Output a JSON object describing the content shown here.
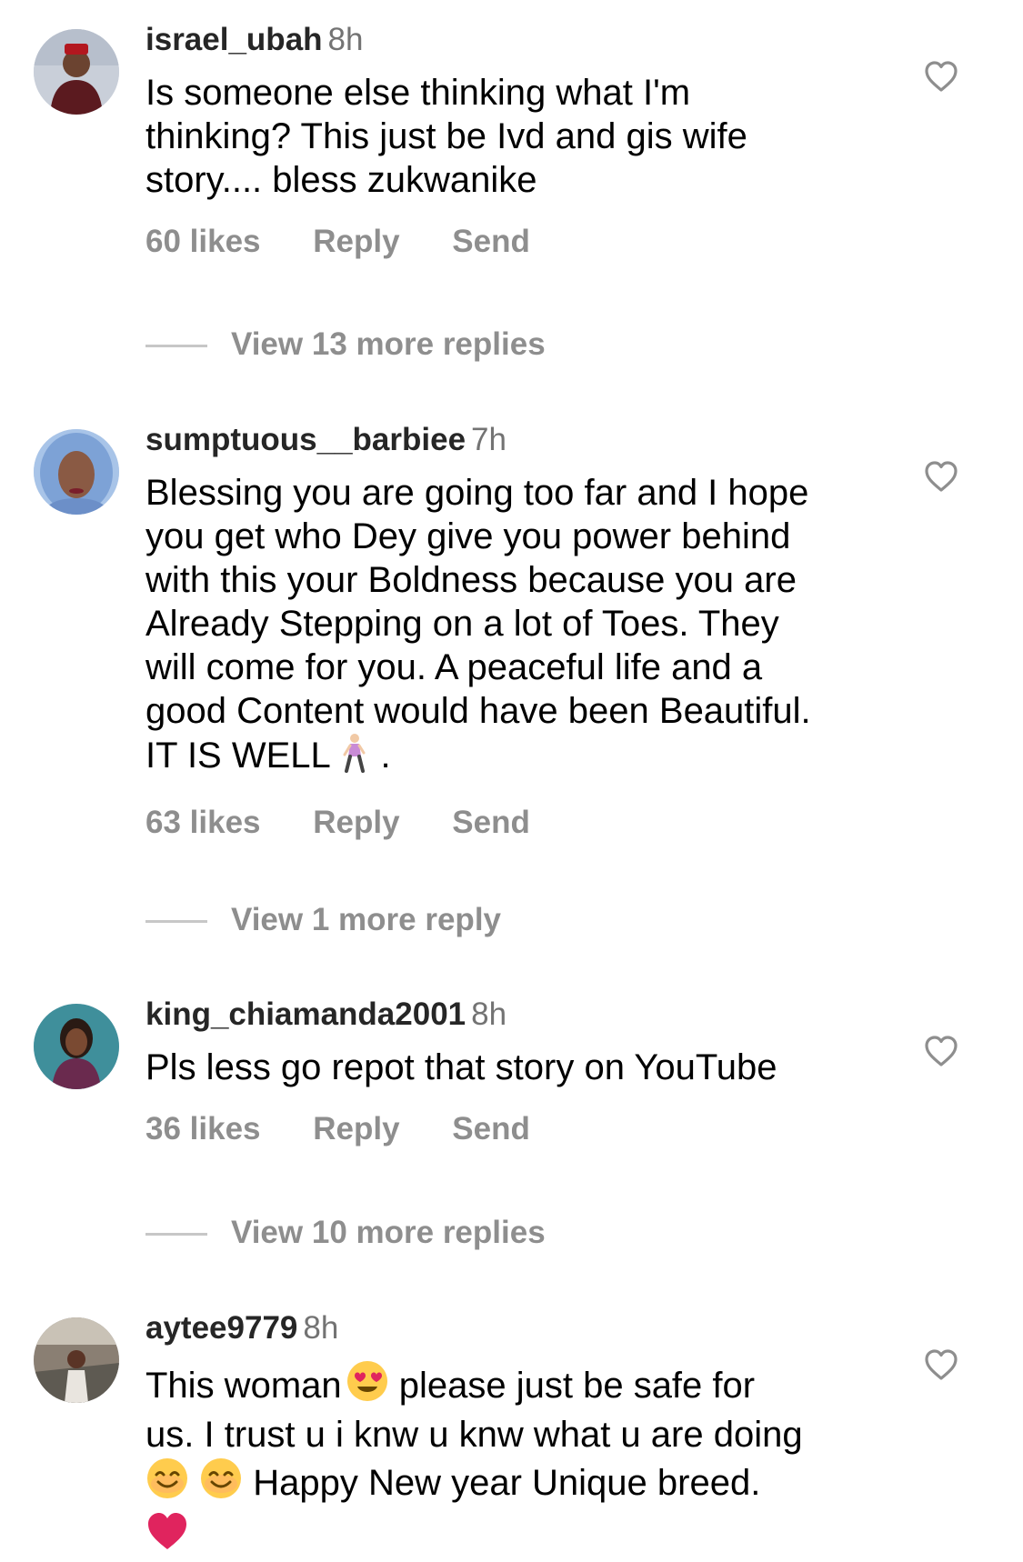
{
  "comments": [
    {
      "username": "israel_ubah",
      "time": "8h",
      "text_lines": [
        "Is someone else thinking what I'm",
        "thinking? This just be  Ivd and gis wife",
        "story.... bless zukwanike"
      ],
      "likes": "60 likes",
      "reply": "Reply",
      "send": "Send",
      "view_replies": "View 13 more replies",
      "avatar_icon": "avatar-man-red-cap"
    },
    {
      "username": "sumptuous__barbiee",
      "time": "7h",
      "text_lines": [
        "Blessing you are going too far and I hope",
        "you get who Dey give you power behind",
        "with this your Boldness because you are",
        "Already Stepping on a lot of Toes. They",
        "will come for you. A peaceful life and a",
        "good Content would have been Beautiful.",
        "IT IS WELL"
      ],
      "last_line_suffix": " .",
      "last_line_emoji": "woman-walking-emoji",
      "likes": "63 likes",
      "reply": "Reply",
      "send": "Send",
      "view_replies": "View 1 more reply",
      "avatar_icon": "avatar-woman-blue-hair"
    },
    {
      "username": "king_chiamanda2001",
      "time": "8h",
      "text_lines": [
        "Pls less go repot that story on YouTube"
      ],
      "likes": "36 likes",
      "reply": "Reply",
      "send": "Send",
      "view_replies": "View 10 more replies",
      "avatar_icon": "avatar-woman-teal-bg"
    },
    {
      "username": "aytee9779",
      "time": "8h",
      "text_line1_a": "This woman",
      "text_line1_b": " please just be safe for",
      "text_line2": "us. I trust u i knw u knw what u are doing",
      "text_line3": " Happy New year Unique breed.",
      "emojis": [
        "heart-eyes-emoji",
        "smiling-emoji",
        "smiling-emoji",
        "red-heart-emoji"
      ],
      "avatar_icon": "avatar-woman-outdoor"
    }
  ],
  "colors": {
    "username": "#262626",
    "meta": "#8e8e8e",
    "time": "#737373",
    "heart_outline": "#8e8e8e"
  },
  "icons": {
    "like": "heart-outline-icon"
  }
}
